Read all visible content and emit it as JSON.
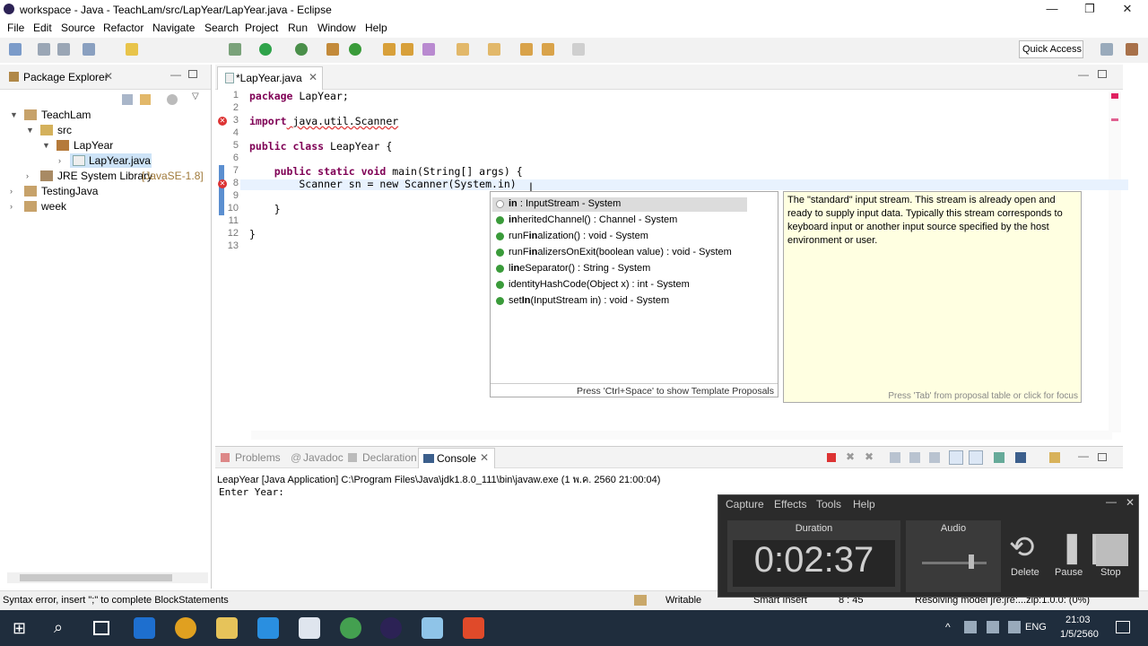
{
  "window": {
    "title": "workspace - Java - TeachLam/src/LapYear/LapYear.java - Eclipse",
    "minimize": "—",
    "maximize": "❐",
    "close": "✕"
  },
  "menu": [
    "File",
    "Edit",
    "Source",
    "Refactor",
    "Navigate",
    "Search",
    "Project",
    "Run",
    "Window",
    "Help"
  ],
  "toolbar": {
    "quick_access": "Quick Access"
  },
  "package_explorer": {
    "tab": "Package Explorer",
    "tree": [
      "TeachLam",
      "src",
      "LapYear",
      "LapYear.java",
      "JRE System Library",
      "[JavaSE-1.8]",
      "TestingJava",
      "week"
    ]
  },
  "editor": {
    "tab": "*LapYear.java",
    "line_numbers": [
      "1",
      "2",
      "3",
      "4",
      "5",
      "6",
      "7",
      "8",
      "9",
      "10",
      "11",
      "12",
      "13"
    ],
    "code": [
      {
        "kw": "package",
        "rest": " LapYear;"
      },
      {
        "kw": "",
        "rest": ""
      },
      {
        "kw": "import",
        "rest": " java.util.Scanner"
      },
      {
        "kw": "",
        "rest": ""
      },
      {
        "kw": "public class",
        "rest": " LeapYear {"
      },
      {
        "kw": "",
        "rest": ""
      },
      {
        "kw": "    public static void",
        "rest": " main(String[] args) {"
      },
      {
        "kw": "",
        "rest": "        Scanner sn = new Scanner(System.in)"
      },
      {
        "kw": "",
        "rest": ""
      },
      {
        "kw": "",
        "rest": "    }"
      },
      {
        "kw": "",
        "rest": ""
      },
      {
        "kw": "",
        "rest": "}"
      },
      {
        "kw": "",
        "rest": ""
      }
    ]
  },
  "proposals": {
    "items": [
      {
        "bold": "in",
        "rest": " : InputStream - System"
      },
      {
        "bold": "in",
        "rest": "heritedChannel() : Channel - System"
      },
      {
        "bold": "",
        "rest": "runF",
        "boldmid": "in",
        "rest2": "alization() : void - System"
      },
      {
        "bold": "",
        "rest": "runF",
        "boldmid": "in",
        "rest2": "alizersOnExit(boolean value) : void - System"
      },
      {
        "bold": "",
        "rest": "l",
        "boldmid": "in",
        "rest2": "eSeparator() : String - System"
      },
      {
        "bold": "",
        "rest": "identityHashCode(Object x) : int - System"
      },
      {
        "bold": "",
        "rest": "set",
        "boldmid": "In",
        "rest2": "(InputStream in) : void - System"
      }
    ],
    "footer": "Press 'Ctrl+Space' to show Template Proposals"
  },
  "javadoc": {
    "text": "The \"standard\" input stream. This stream is already open and ready to supply input data. Typically this stream corresponds to keyboard input or another input source specified by the host environment or user.",
    "footer": "Press 'Tab' from proposal table or click for focus"
  },
  "console": {
    "tabs": [
      "Problems",
      "Javadoc",
      "Declaration",
      "Console"
    ],
    "launch": "LeapYear [Java Application] C:\\Program Files\\Java\\jdk1.8.0_111\\bin\\javaw.exe (1 พ.ค. 2560 21:00:04)",
    "output": "Enter Year:"
  },
  "status": {
    "message": "Syntax error, insert \";\" to complete BlockStatements",
    "writable": "Writable",
    "insert": "Smart Insert",
    "position": "8 : 45",
    "resolving": "Resolving model jre:jre:...zip:1.0.0: (0%)"
  },
  "recorder": {
    "menu": [
      "Capture",
      "Effects",
      "Tools",
      "Help"
    ],
    "duration_label": "Duration",
    "duration": "0:02:37",
    "audio_label": "Audio",
    "delete": "Delete",
    "pause": "Pause",
    "stop": "Stop"
  },
  "taskbar": {
    "lang": "ENG",
    "time": "21:03",
    "date": "1/5/2560"
  }
}
